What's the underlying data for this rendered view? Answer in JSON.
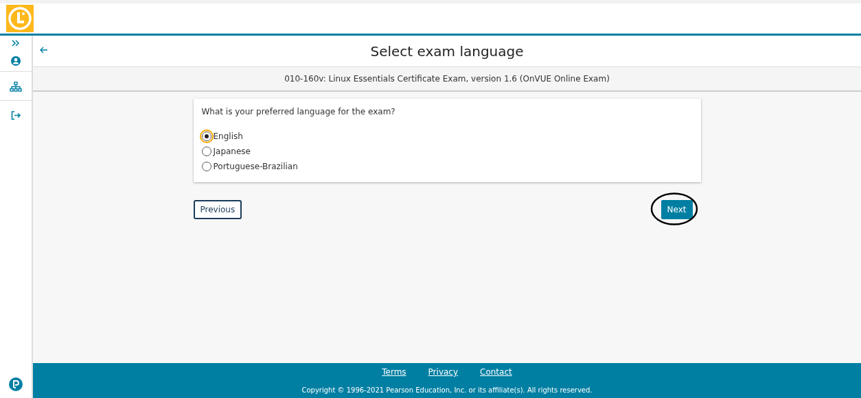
{
  "page": {
    "title": "Select exam language",
    "subtitle": "010-160v: Linux Essentials Certificate Exam, version 1.6 (OnVUE Online Exam)"
  },
  "question": {
    "text": "What is your preferred language for the exam?",
    "options": [
      {
        "label": "English",
        "selected": true
      },
      {
        "label": "Japanese",
        "selected": false
      },
      {
        "label": "Portuguese-Brazilian",
        "selected": false
      }
    ]
  },
  "buttons": {
    "previous": "Previous",
    "next": "Next",
    "next_circled": true
  },
  "footer": {
    "links": [
      "Terms",
      "Privacy",
      "Contact"
    ],
    "copyright": "Copyright © 1996-2021 Pearson Education, Inc. or its affiliate(s). All rights reserved."
  }
}
